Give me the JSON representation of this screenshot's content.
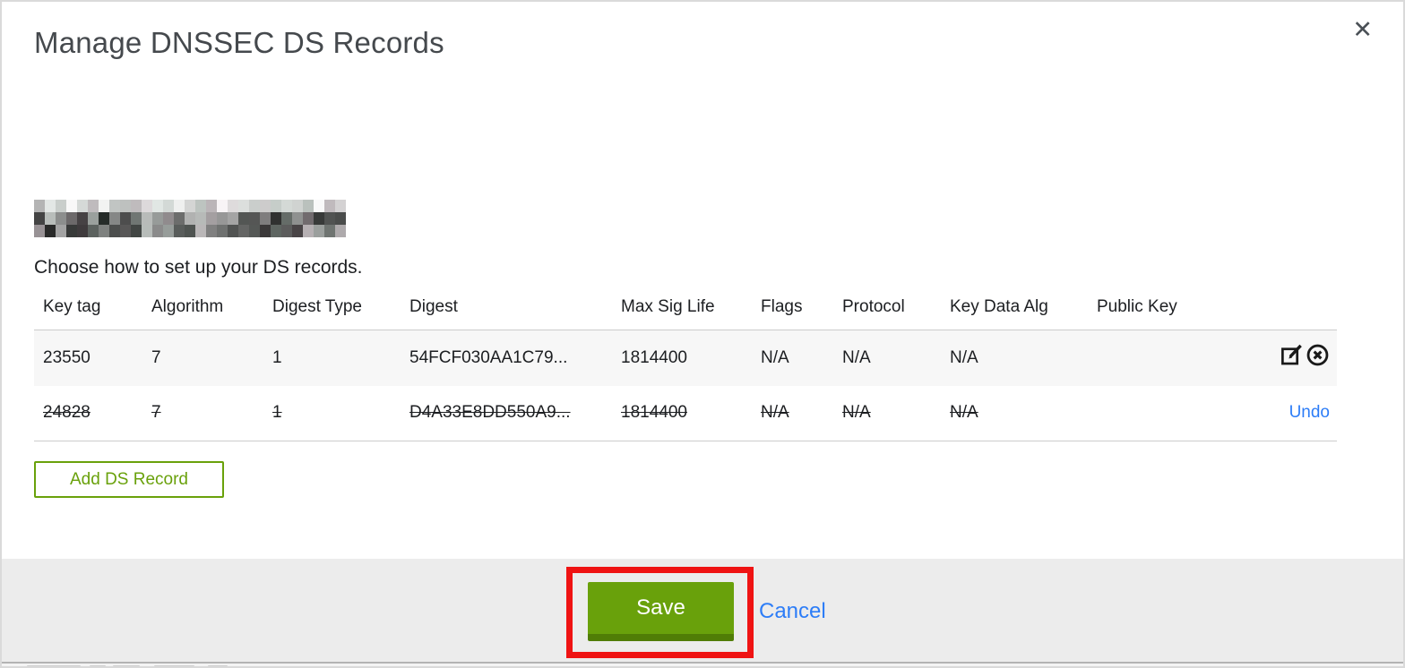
{
  "modal": {
    "title": "Manage DNSSEC DS Records",
    "close_glyph": "✕",
    "subtitle": "Choose how to set up your DS records.",
    "domain_redacted": true
  },
  "table": {
    "columns": [
      "Key tag",
      "Algorithm",
      "Digest Type",
      "Digest",
      "Max Sig Life",
      "Flags",
      "Protocol",
      "Key Data Alg",
      "Public Key"
    ],
    "rows": [
      {
        "cells": [
          "23550",
          "7",
          "1",
          "54FCF030AA1C79...",
          "1814400",
          "N/A",
          "N/A",
          "N/A",
          ""
        ],
        "state": "normal",
        "action_icons": [
          "edit-icon",
          "delete-circle-x-icon"
        ]
      },
      {
        "cells": [
          "24828",
          "7",
          "1",
          "D4A33E8DD550A9...",
          "1814400",
          "N/A",
          "N/A",
          "N/A",
          ""
        ],
        "state": "deleted",
        "undo_label": "Undo"
      }
    ]
  },
  "buttons": {
    "add_ds_record": "Add DS Record",
    "save": "Save",
    "cancel": "Cancel"
  },
  "colors": {
    "action_green": "#69a10b",
    "action_green_dark": "#507d06",
    "link_blue": "#2d7df7",
    "annotation_red": "#ef1313",
    "footer_bg": "#ececec",
    "row_alt_bg": "#f7f7f7"
  }
}
